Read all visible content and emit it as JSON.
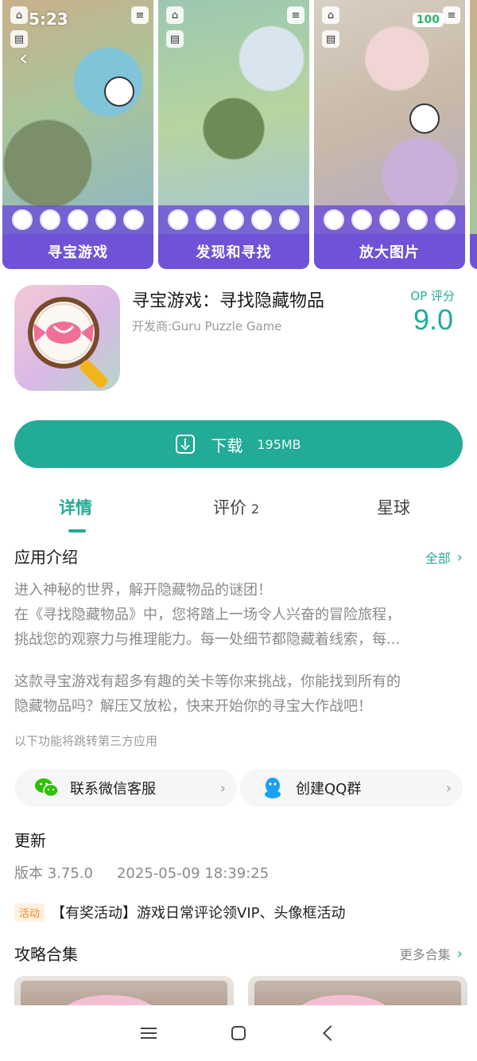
{
  "status_bar": {
    "time": "5:23",
    "battery": "100"
  },
  "screenshots": [
    {
      "caption": "寻宝游戏",
      "color": "#6f52d6"
    },
    {
      "caption": "发现和寻找",
      "color": "#6f52d6"
    },
    {
      "caption": "放大图片",
      "color": "#6f52d6"
    }
  ],
  "app": {
    "title": "寻宝游戏：寻找隐藏物品",
    "developer": "开发商:Guru Puzzle Game",
    "rating_label": "OP 评分",
    "rating_value": "9.0"
  },
  "download": {
    "label": "下载",
    "size": "195MB",
    "color": "#22ab96"
  },
  "tabs": [
    {
      "label": "详情",
      "active": true
    },
    {
      "label": "评价",
      "count": "2"
    },
    {
      "label": "星球"
    }
  ],
  "intro": {
    "title": "应用介绍",
    "more": "全部",
    "para1": [
      "进入神秘的世界，解开隐藏物品的谜团！",
      "在《寻找隐藏物品》中，您将踏上一场令人兴奋的冒险旅程，",
      "挑战您的观察力与推理能力。每一处细节都隐藏着线索，每..."
    ],
    "para2": [
      "这款寻宝游戏有超多有趣的关卡等你来挑战，你能找到所有的",
      "隐藏物品吗？解压又放松，快来开始你的寻宝大作战吧！"
    ],
    "third_party_note": "以下功能将跳转第三方应用"
  },
  "contacts": {
    "wechat_label": "联系微信客服",
    "qq_label": "创建QQ群"
  },
  "update": {
    "title": "更新",
    "version": "版本 3.75.0",
    "date": "2025-05-09 18:39:25",
    "activity_badge": "活动",
    "activity_text": "【有奖活动】游戏日常评论领VIP、头像框活动"
  },
  "guides": {
    "title": "攻略合集",
    "more": "更多合集"
  }
}
